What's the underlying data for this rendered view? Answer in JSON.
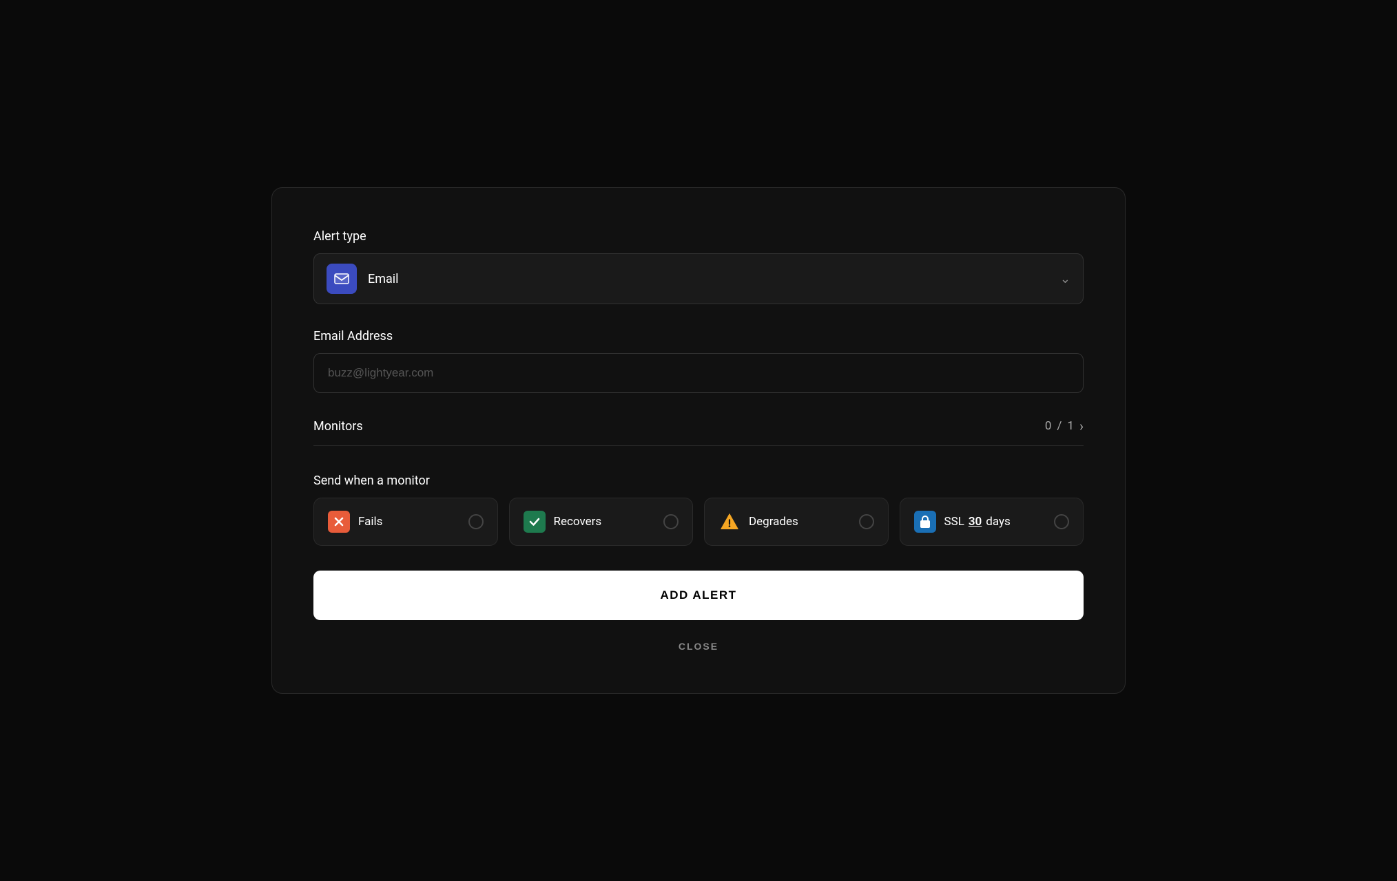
{
  "modal": {
    "alert_type": {
      "label": "Alert type",
      "selected": "Email",
      "icon": "email-icon",
      "chevron": "▾"
    },
    "email_address": {
      "label": "Email Address",
      "placeholder": "buzz@lightyear.com"
    },
    "monitors": {
      "label": "Monitors",
      "current": "0",
      "separator": "/",
      "total": "1",
      "nav_arrow": "›"
    },
    "send_when": {
      "label": "Send when a monitor",
      "options": [
        {
          "id": "fails",
          "label": "Fails",
          "icon_type": "x",
          "icon_bg": "#e85c3a"
        },
        {
          "id": "recovers",
          "label": "Recovers",
          "icon_type": "check",
          "icon_bg": "#1e7a4e"
        },
        {
          "id": "degrades",
          "label": "Degrades",
          "icon_type": "warning",
          "icon_bg": "transparent"
        },
        {
          "id": "ssl",
          "label": "SSL",
          "days": "30",
          "days_suffix": "days",
          "icon_type": "lock",
          "icon_bg": "#1a6fb5"
        }
      ]
    },
    "add_alert_button": "ADD ALERT",
    "close_button": "CLOSE"
  }
}
